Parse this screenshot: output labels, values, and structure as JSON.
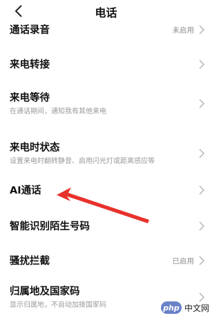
{
  "header": {
    "title": "电话"
  },
  "rows": [
    {
      "label": "通话录音",
      "status": "未启用"
    },
    {
      "label": "来电转接"
    },
    {
      "label": "来电等待",
      "subtitle": "在通话期间，通知我有其他来电"
    },
    {
      "label": "来电时状态",
      "subtitle": "设置来电时翻转静音、启用闪光灯或距离感应等"
    },
    {
      "label": "AI通话"
    },
    {
      "label": "智能识别陌生号码"
    },
    {
      "label": "骚扰拦截",
      "status": "已启用"
    },
    {
      "label": "归属地及国家码",
      "subtitle": "显示归属地，不自动加拨国家码"
    }
  ],
  "watermark": {
    "logo_text": "php",
    "text": "中文网"
  },
  "colors": {
    "annotation_arrow": "#e8312b",
    "watermark_logo": "#6a82c7"
  }
}
